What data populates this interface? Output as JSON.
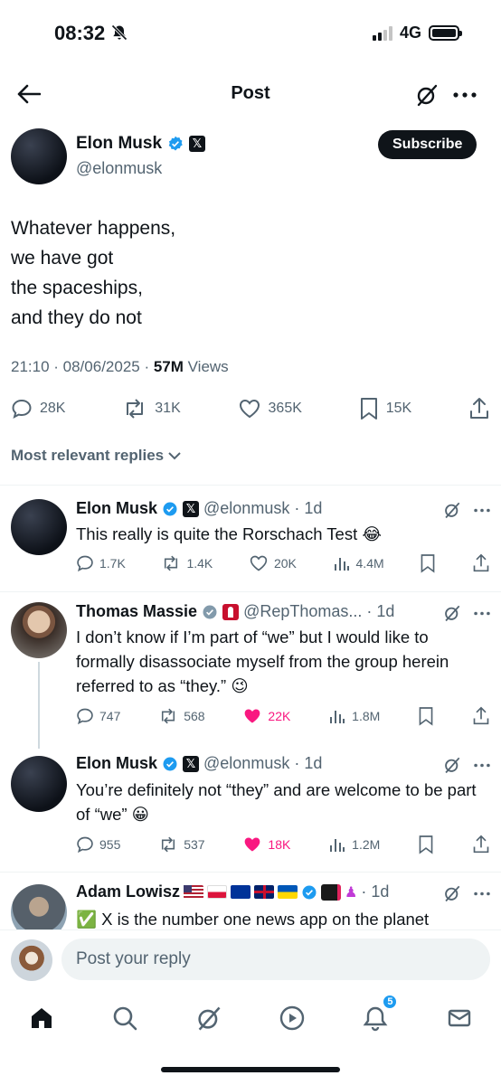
{
  "status_bar": {
    "time": "08:32",
    "network": "4G"
  },
  "header": {
    "title": "Post"
  },
  "post": {
    "author_name": "Elon Musk",
    "author_handle": "@elonmusk",
    "subscribe_label": "Subscribe",
    "text": "Whatever happens,\nwe have got\nthe spaceships,\nand they do not",
    "timestamp": "21:10 · 08/06/2025 · ",
    "views_count": "57M",
    "views_label": " Views",
    "stats": {
      "replies": "28K",
      "reposts": "31K",
      "likes": "365K",
      "bookmarks": "15K"
    }
  },
  "sort_label": "Most relevant replies",
  "replies": [
    {
      "name": "Elon Musk",
      "handle": "@elonmusk",
      "time": "· 1d",
      "text": "This really is quite the Rorschach Test 😂",
      "stats": {
        "replies": "1.7K",
        "reposts": "1.4K",
        "likes": "20K",
        "views": "4.4M"
      }
    },
    {
      "name": "Thomas Massie",
      "handle": "@RepThomas...",
      "time": "· 1d",
      "text": "I don’t know if I’m part of “we” but I would like to formally disassociate myself from the group herein referred to as “they.” 😉",
      "stats": {
        "replies": "747",
        "reposts": "568",
        "likes": "22K",
        "views": "1.8M"
      }
    },
    {
      "name": "Elon Musk",
      "handle": "@elonmusk",
      "time": "· 1d",
      "text": "You’re definitely not “they” and are welcome to be part of “we” 😀",
      "stats": {
        "replies": "955",
        "reposts": "537",
        "likes": "18K",
        "views": "1.2M"
      }
    },
    {
      "name": "Adam Lowisz",
      "handle": "",
      "time": "· 1d",
      "text": "✅ X is the number one news app on the planet"
    }
  ],
  "composer": {
    "placeholder": "Post your reply"
  },
  "tabbar": {
    "notifications_badge": "5"
  },
  "colors": {
    "accent": "#1d9bf0",
    "like": "#f91880",
    "text": "#0f1419",
    "muted": "#536471"
  }
}
